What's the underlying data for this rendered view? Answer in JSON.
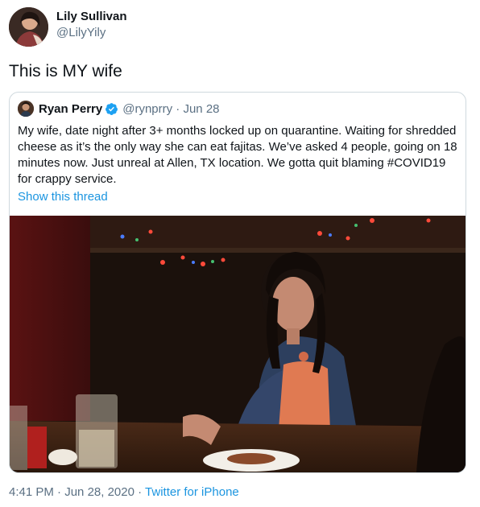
{
  "tweet": {
    "author_name": "Lily Sullivan",
    "author_handle": "@LilyYily",
    "text": "This is MY wife",
    "time": "4:41 PM",
    "separator": "·",
    "date": "Jun 28, 2020",
    "source": "Twitter for iPhone"
  },
  "quoted": {
    "name": "Ryan Perry",
    "handle": "@rynprry",
    "separator": "·",
    "date": "Jun 28",
    "text": "My wife, date night after 3+ months locked up on quarantine. Waiting for shredded cheese as it’s the only way she can eat fajitas. We’ve asked 4 people, going on 18 minutes now. Just unreal at Allen, TX location. We gotta quit blaming #COVID19 for crappy service.",
    "thread_link": "Show this thread",
    "verified": true,
    "icons": [
      "verified-badge-icon"
    ]
  },
  "colors": {
    "link": "#1b95e0",
    "secondary_text": "#5b7083",
    "border": "#cfd9de",
    "verified": "#1da1f2"
  }
}
